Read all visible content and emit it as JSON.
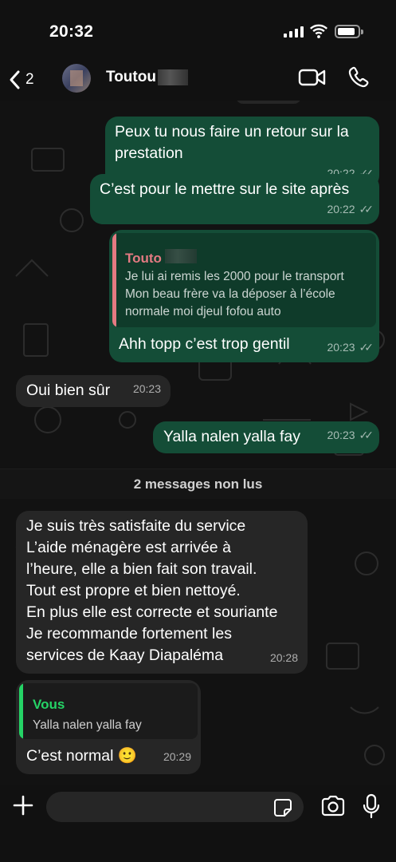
{
  "status_bar": {
    "time": "20:32"
  },
  "header": {
    "back_count": "2",
    "contact_name": "Toutou"
  },
  "messages": [
    {
      "id": "m1",
      "dir": "out",
      "lines": [
        "Peux tu nous faire un retour sur la",
        "prestation"
      ],
      "time": "20:22"
    },
    {
      "id": "m2",
      "dir": "out",
      "lines": [
        "C’est pour le mettre sur le site après"
      ],
      "time": "20:22"
    },
    {
      "id": "m3",
      "dir": "out",
      "quote": {
        "name": "Touto",
        "lines": [
          "Je lui ai remis les 2000 pour le transport",
          "Mon beau frère va la déposer à l’école",
          "normale moi djeul fofou auto"
        ]
      },
      "lines": [
        "Ahh topp c’est trop gentil"
      ],
      "time": "20:23"
    },
    {
      "id": "m4",
      "dir": "in",
      "lines": [
        "Oui bien sûr"
      ],
      "time": "20:23"
    },
    {
      "id": "m5",
      "dir": "out",
      "lines": [
        "Yalla nalen yalla fay"
      ],
      "time": "20:23"
    },
    {
      "id": "m6",
      "dir": "in",
      "lines": [
        "Je suis très satisfaite du service",
        "L’aide ménagère est arrivée à",
        "l’heure, elle a bien fait son travail.",
        "Tout est propre et bien nettoyé.",
        "En plus elle est correcte et souriante",
        "Je recommande fortement les",
        "services de Kaay Diapaléma"
      ],
      "time": "20:28"
    },
    {
      "id": "m7",
      "dir": "out_reply",
      "quote": {
        "name": "Vous",
        "lines": [
          "Yalla nalen yalla fay"
        ]
      },
      "lines": [
        "C’est normal 🙂"
      ],
      "time": "20:29"
    }
  ],
  "unread_divider": "2 messages non lus",
  "composer": {
    "placeholder": ""
  },
  "colors": {
    "outgoing_bubble": "#144d37",
    "incoming_bubble": "#262626",
    "quote_touto": "#e47a82",
    "quote_vous": "#25d366",
    "background": "#121212"
  },
  "icons": [
    "back-chevron-icon",
    "video-call-icon",
    "phone-call-icon",
    "plus-icon",
    "sticker-icon",
    "camera-icon",
    "microphone-icon"
  ]
}
